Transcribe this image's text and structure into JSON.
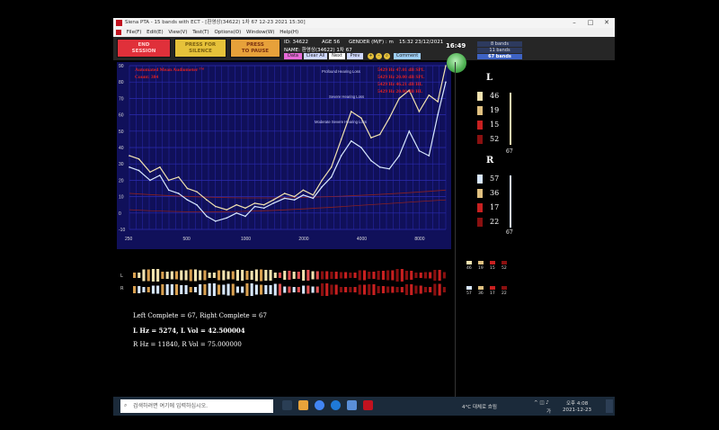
{
  "window": {
    "title": "Siena PTA - 15 bands with ECT - [환영상(34622) 1차 67 12-23 2021 15:30]",
    "controls": [
      "–",
      "□",
      "✕"
    ]
  },
  "menu": [
    "File(F)",
    "Edit(E)",
    "View(V)",
    "Test(T)",
    "Options(O)",
    "Window(W)",
    "Help(H)"
  ],
  "toolbar": {
    "buttons": [
      {
        "label": "END\nSESSION",
        "bg": "#e0303a",
        "fg": "#ffd0d0"
      },
      {
        "label": "PRESS FOR\nSILENCE",
        "bg": "#e6c23a",
        "fg": "#7a5f10"
      },
      {
        "label": "PRESS\nTO PAUSE",
        "bg": "#e7a13a",
        "fg": "#7a3010"
      }
    ],
    "id_label": "ID: 34622",
    "age_label": "AGE 56",
    "gender_label": "GENDER (M/F) : m",
    "name_label": "NAME: 환영상(34622) 1차 67",
    "datetime_label": "15:32 23/12/2021",
    "small_buttons": [
      "Data",
      "Clear All",
      "Next",
      "Prev",
      "Comment"
    ],
    "clock": "16:49",
    "band_buttons": [
      "8 bands",
      "11 bands",
      "67 bands"
    ]
  },
  "graph": {
    "overlay_title": "Automated Mean Audiometer ™",
    "overlay_count": "Count: 384",
    "readouts": [
      "5429 Hz 47.01 dB SPL",
      "5429 Hz 20.00 dB SPL",
      "5429 Hz 46.21 dB HL",
      "5429 Hz 20.00 dB HL"
    ],
    "zones": [
      "Profound Hearing Loss",
      "Severe Hearing Loss",
      "Moderate Severe Hearing Loss"
    ],
    "colors": {
      "background": "#10105a",
      "grid": "#2a2ab0",
      "left": "#f2e3b0",
      "right": "#d8e8ff"
    }
  },
  "chart_data": {
    "type": "line",
    "title": "Automated Mean Audiometer ™",
    "xlabel": "",
    "ylabel": "",
    "xscale": "log",
    "xticks": [
      250,
      500,
      1000,
      2000,
      4000,
      8000
    ],
    "xlim": [
      250,
      11000
    ],
    "ylim": [
      -10,
      90
    ],
    "yticks": [
      -10,
      0,
      10,
      20,
      30,
      40,
      50,
      60,
      70,
      80,
      90
    ],
    "series": [
      {
        "name": "L",
        "color": "#f2e3b0",
        "x": [
          250,
          280,
          320,
          360,
          400,
          450,
          500,
          560,
          630,
          700,
          800,
          900,
          1000,
          1120,
          1250,
          1400,
          1600,
          1800,
          2000,
          2250,
          2500,
          2800,
          3150,
          3550,
          4000,
          4500,
          5000,
          5600,
          6300,
          7100,
          8000,
          9000,
          10000,
          11000
        ],
        "values": [
          35,
          33,
          25,
          28,
          20,
          22,
          15,
          13,
          8,
          4,
          2,
          5,
          3,
          6,
          5,
          8,
          12,
          10,
          14,
          11,
          20,
          28,
          45,
          62,
          58,
          46,
          48,
          58,
          70,
          75,
          62,
          72,
          68,
          90
        ]
      },
      {
        "name": "R",
        "color": "#d8e8ff",
        "x": [
          250,
          280,
          320,
          360,
          400,
          450,
          500,
          560,
          630,
          700,
          800,
          900,
          1000,
          1120,
          1250,
          1400,
          1600,
          1800,
          2000,
          2250,
          2500,
          2800,
          3150,
          3550,
          4000,
          4500,
          5000,
          5600,
          6300,
          7100,
          8000,
          9000,
          10000,
          11000
        ],
        "values": [
          28,
          26,
          20,
          23,
          14,
          12,
          8,
          5,
          -2,
          -5,
          -3,
          0,
          -2,
          4,
          3,
          6,
          9,
          8,
          11,
          9,
          16,
          22,
          35,
          44,
          40,
          32,
          28,
          27,
          35,
          50,
          38,
          35,
          60,
          80
        ]
      }
    ]
  },
  "strips": {
    "left_label": "L",
    "right_label": "R"
  },
  "side": {
    "left": {
      "label": "L",
      "values": [
        "46",
        "19",
        "15",
        "52"
      ],
      "colors": [
        "#f2e3b0",
        "#e0c080",
        "#c82020",
        "#8a1010"
      ],
      "total": "67"
    },
    "right": {
      "label": "R",
      "values": [
        "57",
        "36",
        "17",
        "22"
      ],
      "colors": [
        "#d8e8ff",
        "#e0c080",
        "#c82020",
        "#8a1010"
      ],
      "total": "67"
    },
    "mini_left": [
      "46",
      "19",
      "15",
      "52"
    ],
    "mini_right": [
      "57",
      "36",
      "17",
      "22"
    ]
  },
  "stats": {
    "complete": "Left Complete = 67,  Right Complete = 67",
    "l_line": "L Hz = 5274, L Vol = 42.500004",
    "r_line": "R Hz = 11840, R Vol = 75.000000"
  },
  "taskbar": {
    "search_placeholder": "검색하려면 여기에 입력하십시오.",
    "weather": "4°C 대체로 흐림",
    "lang": "가",
    "time": "오후 4:08",
    "date": "2021-12-23"
  }
}
